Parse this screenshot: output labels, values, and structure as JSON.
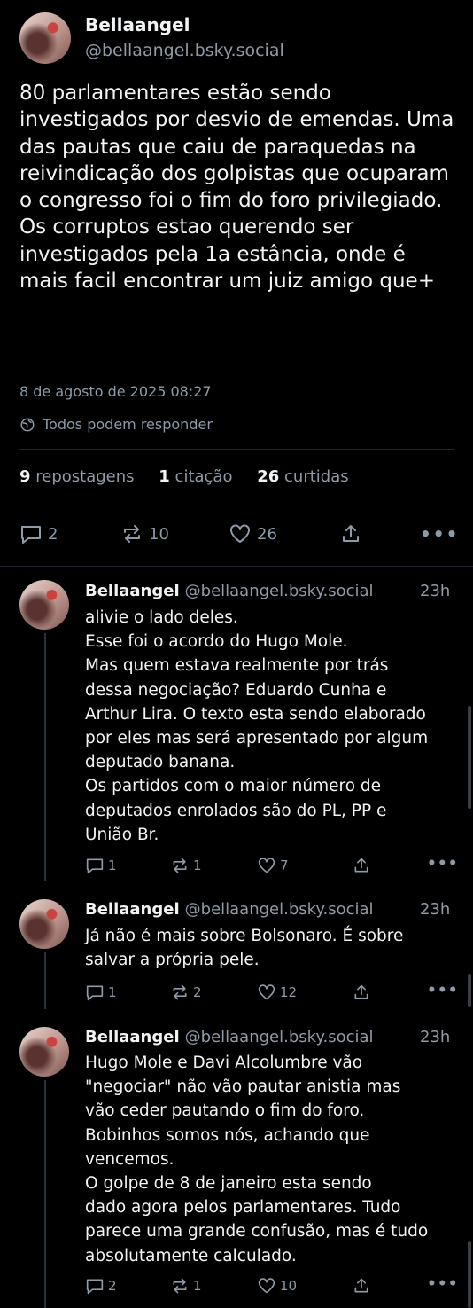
{
  "main_post": {
    "author": "Bellaangel",
    "handle": "@bellaangel.bsky.social",
    "text": "80 parlamentares estão sendo investigados por desvio de emendas. Uma das pautas que caiu de paraquedas na reivindicação dos golpistas que ocuparam o congresso foi o fim do foro privilegiado. Os corruptos estao querendo ser investigados pela 1a estância, onde é mais facil encontrar um juiz amigo que+",
    "timestamp": "8 de agosto de 2025 08:27",
    "reply_setting": "Todos podem responder",
    "reposts_count": "9",
    "reposts_label": "repostagens",
    "quotes_count": "1",
    "quotes_label": "citação",
    "likes_count": "26",
    "likes_label": "curtidas",
    "actions": {
      "replies": "2",
      "reposts": "10",
      "likes": "26"
    }
  },
  "replies": [
    {
      "author": "Bellaangel",
      "handle": "@bellaangel.bsky.social",
      "time": "23h",
      "lines": [
        "alivie o lado deles.",
        "Esse foi o acordo do Hugo Mole.",
        "Mas quem estava realmente por trás",
        "dessa negociação? Eduardo Cunha e",
        "Arthur Lira. O texto esta sendo elaborado",
        "por eles mas será apresentado por algum",
        "deputado banana.",
        "Os partidos com o maior número de",
        "deputados enrolados são do PL, PP e",
        "União Br."
      ],
      "replies": "1",
      "reposts": "1",
      "likes": "7"
    },
    {
      "author": "Bellaangel",
      "handle": "@bellaangel.bsky.social",
      "time": "23h",
      "lines": [
        "Já não é mais sobre Bolsonaro. É sobre",
        "salvar a própria pele."
      ],
      "replies": "1",
      "reposts": "2",
      "likes": "12"
    },
    {
      "author": "Bellaangel",
      "handle": "@bellaangel.bsky.social",
      "time": "23h",
      "lines": [
        "Hugo Mole e Davi Alcolumbre vão",
        "\"negociar\" não vão pautar anistia mas",
        "vão ceder pautando o fim do foro.",
        "Bobinhos somos nós, achando que",
        "vencemos.",
        "O golpe de 8 de janeiro esta sendo",
        "dado agora pelos parlamentares. Tudo",
        "parece uma grande confusão, mas é tudo",
        "absolutamente calculado."
      ],
      "replies": "2",
      "reposts": "1",
      "likes": "10"
    }
  ]
}
